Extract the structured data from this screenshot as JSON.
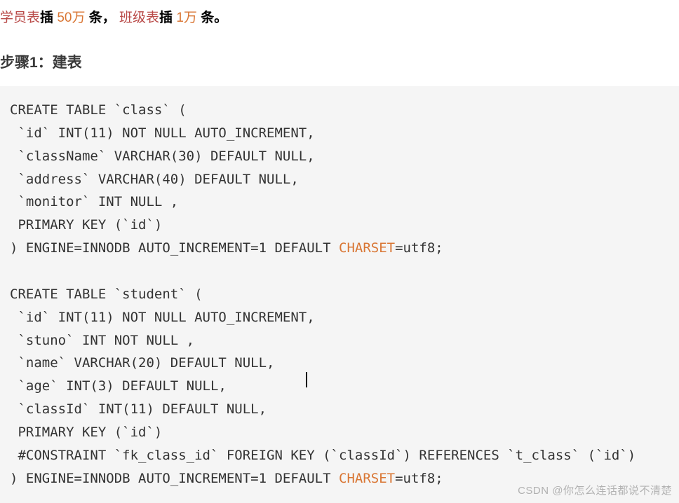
{
  "intro": {
    "prefix_red": "学员表",
    "action1": "插",
    "count1": "50万",
    "unit1": "条，",
    "span_red2": "班级表",
    "action2": "插",
    "count2": "1万",
    "unit2": "条。"
  },
  "section_title": "步骤1：建表",
  "code": {
    "line01": "CREATE TABLE `class` (",
    "line02": " `id` INT(11) NOT NULL AUTO_INCREMENT,",
    "line03": " `className` VARCHAR(30) DEFAULT NULL,",
    "line04": " `address` VARCHAR(40) DEFAULT NULL,",
    "line05": " `monitor` INT NULL ,",
    "line06": " PRIMARY KEY (`id`)",
    "line07a": ") ENGINE=INNODB AUTO_INCREMENT=1 DEFAULT ",
    "line07_hl": "CHARSET",
    "line07b": "=utf8;",
    "blank": "",
    "line09": "CREATE TABLE `student` (",
    "line10": " `id` INT(11) NOT NULL AUTO_INCREMENT,",
    "line11": " `stuno` INT NOT NULL ,",
    "line12": " `name` VARCHAR(20) DEFAULT NULL,",
    "line13": " `age` INT(3) DEFAULT NULL,",
    "line14": " `classId` INT(11) DEFAULT NULL,",
    "line15": " PRIMARY KEY (`id`)",
    "line16": " #CONSTRAINT `fk_class_id` FOREIGN KEY (`classId`) REFERENCES `t_class` (`id`)",
    "line17a": ") ENGINE=INNODB AUTO_INCREMENT=1 DEFAULT ",
    "line17_hl": "CHARSET",
    "line17b": "=utf8;"
  },
  "watermark": "CSDN @你怎么连话都说不清楚"
}
